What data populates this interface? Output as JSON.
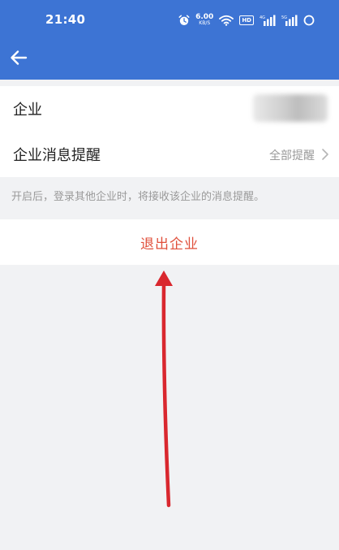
{
  "status_bar": {
    "time": "21:40",
    "net_speed_value": "6.00",
    "net_speed_unit": "KB/S",
    "hd_badge": "HD",
    "signal_1_label": "4G",
    "signal_2_label": "5G"
  },
  "header": {
    "background_color": "#3d74d4"
  },
  "settings": {
    "enterprise_label": "企业",
    "notify_label": "企业消息提醒",
    "notify_value": "全部提醒",
    "hint": "开启后，登录其他企业时，将接收该企业的消息提醒。",
    "exit_label": "退出企业",
    "exit_color": "#e0503c"
  },
  "annotation": {
    "arrow_color": "#d9272e"
  }
}
